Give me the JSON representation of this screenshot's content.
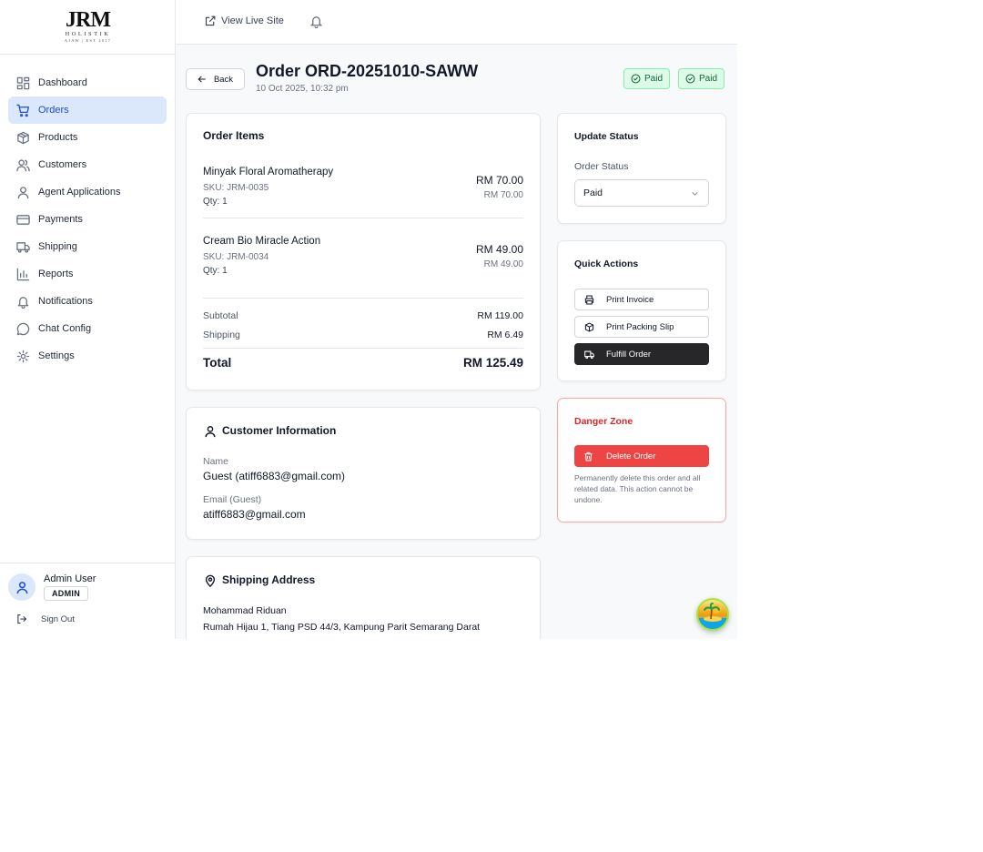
{
  "brand": {
    "mark": "JRM",
    "word": "HOLISTIK",
    "tagline": "AJAW | EST 2017"
  },
  "sidebar": {
    "items": [
      {
        "label": "Dashboard",
        "icon": "dashboard-icon"
      },
      {
        "label": "Orders",
        "icon": "cart-icon",
        "active": true
      },
      {
        "label": "Products",
        "icon": "box-icon"
      },
      {
        "label": "Customers",
        "icon": "users-icon"
      },
      {
        "label": "Agent Applications",
        "icon": "user-icon"
      },
      {
        "label": "Payments",
        "icon": "credit-card-icon"
      },
      {
        "label": "Shipping",
        "icon": "truck-icon"
      },
      {
        "label": "Reports",
        "icon": "bar-chart-icon"
      },
      {
        "label": "Notifications",
        "icon": "bell-icon"
      },
      {
        "label": "Chat Config",
        "icon": "chat-icon"
      },
      {
        "label": "Settings",
        "icon": "gear-icon"
      }
    ]
  },
  "user": {
    "name": "Admin User",
    "role": "ADMIN",
    "signout": "Sign Out"
  },
  "topbar": {
    "view_live": "View Live Site"
  },
  "header": {
    "back": "Back",
    "title": "Order ORD-20251010-SAWW",
    "date": "10 Oct 2025, 10:32 pm",
    "badges": [
      "Paid",
      "Paid"
    ]
  },
  "order_items": {
    "title": "Order Items",
    "items": [
      {
        "name": "Minyak Floral Aromatherapy",
        "sku": "SKU: JRM-0035",
        "qty": "Qty: 1",
        "price": "RM 70.00",
        "unit": "RM 70.00"
      },
      {
        "name": "Cream Bio Miracle Action",
        "sku": "SKU: JRM-0034",
        "qty": "Qty: 1",
        "price": "RM 49.00",
        "unit": "RM 49.00"
      }
    ],
    "subtotal_label": "Subtotal",
    "subtotal": "RM 119.00",
    "shipping_label": "Shipping",
    "shipping": "RM 6.49",
    "total_label": "Total",
    "total": "RM 125.49"
  },
  "customer": {
    "title": "Customer Information",
    "name_label": "Name",
    "name": "Guest (atiff6883@gmail.com)",
    "email_label": "Email (Guest)",
    "email": "atiff6883@gmail.com"
  },
  "shipping_address": {
    "title": "Shipping Address",
    "recipient": "Mohammad Riduan",
    "line1": "Rumah Hijau 1, Tiang PSD 44/3, Kampung Parit Semarang Darat"
  },
  "update_status": {
    "title": "Update Status",
    "label": "Order Status",
    "value": "Paid"
  },
  "quick_actions": {
    "title": "Quick Actions",
    "print_invoice": "Print Invoice",
    "print_packing": "Print Packing Slip",
    "fulfill": "Fulfill Order"
  },
  "danger": {
    "title": "Danger Zone",
    "delete": "Delete Order",
    "note": "Permanently delete this order and all related data. This action cannot be undone."
  },
  "colors": {
    "accent": "#1d4ed8",
    "active_bg": "#dbe7fb",
    "paid_bg": "#dcfce7",
    "paid_text": "#166534",
    "danger": "#ef4444",
    "dark_button": "#27272a"
  }
}
